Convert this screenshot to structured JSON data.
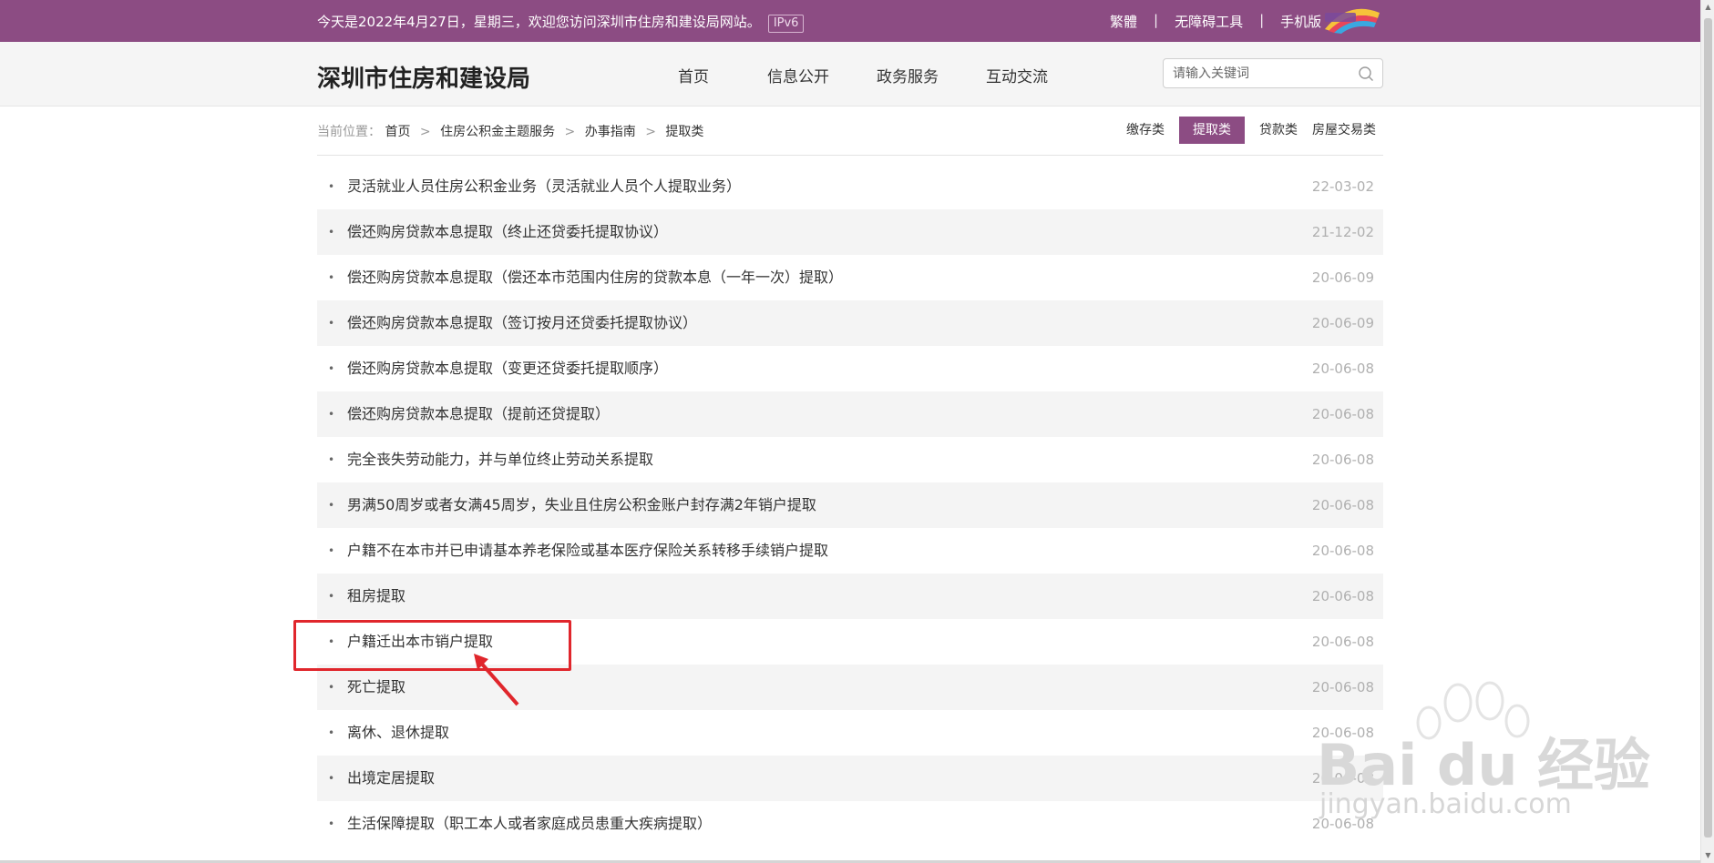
{
  "topbar": {
    "welcome": "今天是2022年4月27日，星期三，欢迎您访问深圳市住房和建设局网站。",
    "ipv6": "IPv6",
    "traditional": "繁體",
    "accessibility": "无障碍工具",
    "mobile": "手机版",
    "separator": "|"
  },
  "header": {
    "site_title": "深圳市住房和建设局",
    "nav": [
      "首页",
      "信息公开",
      "政务服务",
      "互动交流"
    ],
    "search_placeholder": "请输入关键词"
  },
  "breadcrumb": {
    "label": "当前位置：",
    "items": [
      "首页",
      "住房公积金主题服务",
      "办事指南",
      "提取类"
    ],
    "arrow": ">"
  },
  "category_tabs": {
    "items": [
      "缴存类",
      "提取类",
      "贷款类",
      "房屋交易类"
    ],
    "active": "提取类"
  },
  "list": [
    {
      "title": "灵活就业人员住房公积金业务（灵活就业人员个人提取业务）",
      "date": "22-03-02"
    },
    {
      "title": "偿还购房贷款本息提取（终止还贷委托提取协议）",
      "date": "21-12-02"
    },
    {
      "title": "偿还购房贷款本息提取（偿还本市范围内住房的贷款本息（一年一次）提取）",
      "date": "20-06-09"
    },
    {
      "title": "偿还购房贷款本息提取（签订按月还贷委托提取协议）",
      "date": "20-06-09"
    },
    {
      "title": "偿还购房贷款本息提取（变更还贷委托提取顺序）",
      "date": "20-06-08"
    },
    {
      "title": "偿还购房贷款本息提取（提前还贷提取）",
      "date": "20-06-08"
    },
    {
      "title": "完全丧失劳动能力，并与单位终止劳动关系提取",
      "date": "20-06-08"
    },
    {
      "title": "男满50周岁或者女满45周岁，失业且住房公积金账户封存满2年销户提取",
      "date": "20-06-08"
    },
    {
      "title": "户籍不在本市并已申请基本养老保险或基本医疗保险关系转移手续销户提取",
      "date": "20-06-08"
    },
    {
      "title": "租房提取",
      "date": "20-06-08"
    },
    {
      "title": "户籍迁出本市销户提取",
      "date": "20-06-08"
    },
    {
      "title": "死亡提取",
      "date": "20-06-08"
    },
    {
      "title": "离休、退休提取",
      "date": "20-06-08"
    },
    {
      "title": "出境定居提取",
      "date": "20-06-08"
    },
    {
      "title": "生活保障提取（职工本人或者家庭成员患重大疾病提取）",
      "date": "20-06-08"
    }
  ],
  "watermark": {
    "brand": "Bai du 经验",
    "url": "jingyan.baidu.com"
  },
  "colors": {
    "brand_purple": "#8c4c83",
    "highlight_red": "#e0262c"
  }
}
